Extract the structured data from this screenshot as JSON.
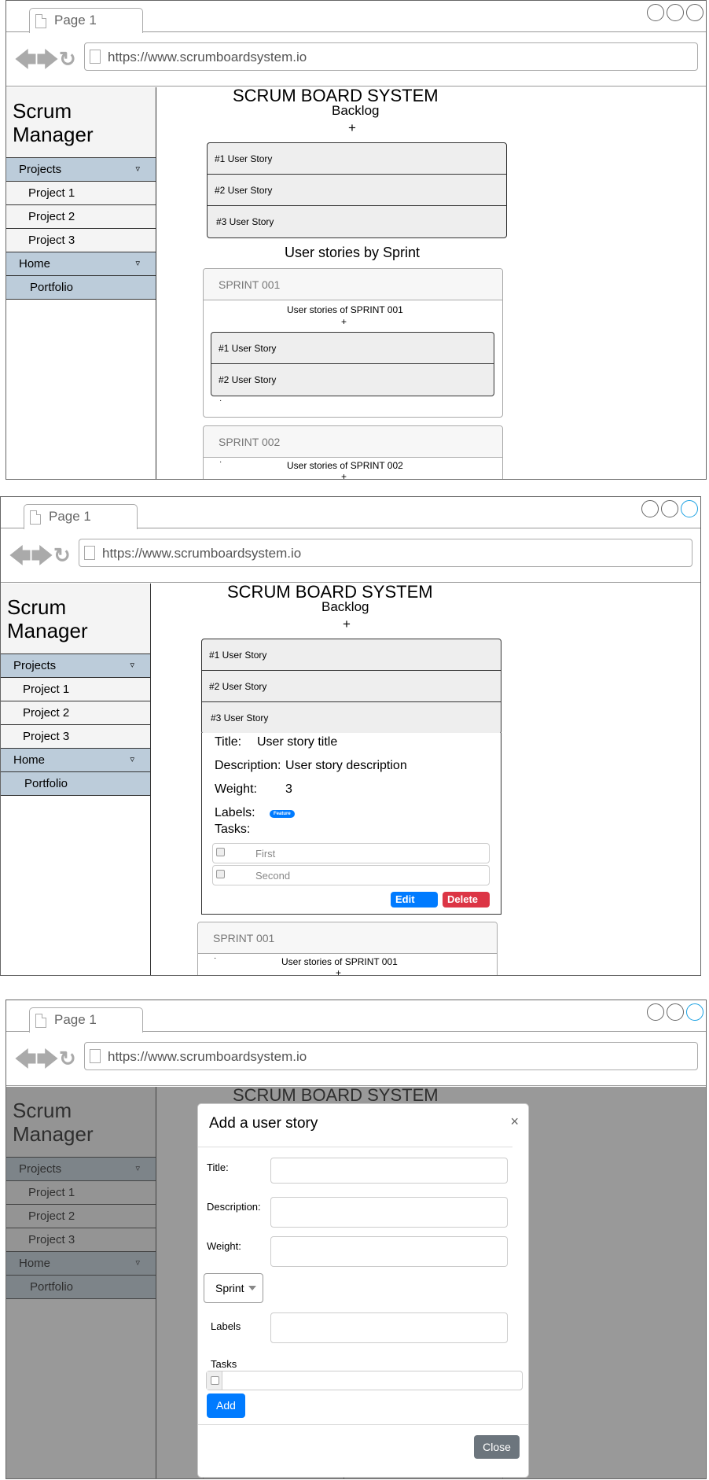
{
  "browser": {
    "tab_label": "Page 1",
    "url": "https://www.scrumboardsystem.io"
  },
  "sidebar": {
    "brand_line1": "Scrum",
    "brand_line2": "Manager",
    "projects_label": "Projects",
    "projects": [
      "Project 1",
      "Project 2",
      "Project 3"
    ],
    "home_label": "Home",
    "portfolio_label": "Portfolio",
    "caret": "▿"
  },
  "board": {
    "title": "SCRUM BOARD SYSTEM",
    "backlog_label": "Backlog",
    "add_symbol": "+",
    "backlog_stories": [
      "#1 User Story",
      "#2 User Story",
      "#3 User Story"
    ],
    "sprints_heading": "User stories by Sprint",
    "sprint_dot": "·",
    "sprints": [
      {
        "name": "SPRINT 001",
        "subtitle": "User stories of SPRINT 001",
        "stories": [
          "#1 User Story",
          "#2 User Story"
        ]
      },
      {
        "name": "SPRINT 002",
        "subtitle": "User stories of SPRINT 002",
        "stories": []
      }
    ]
  },
  "story_detail": {
    "title_label": "Title:",
    "title_value": "User story title",
    "description_label": "Description:",
    "description_value": "User story description",
    "weight_label": "Weight:",
    "weight_value": "3",
    "labels_label": "Labels:",
    "label_badge": "Feature",
    "tasks_label": "Tasks:",
    "tasks": [
      "First",
      "Second"
    ],
    "edit_label": "Edit",
    "delete_label": "Delete"
  },
  "modal": {
    "title": "Add a user story",
    "close_symbol": "×",
    "title_field_label": "Title:",
    "description_field_label": "Description:",
    "weight_field_label": "Weight:",
    "sprint_select_value": "Sprint",
    "labels_field_label": "Labels",
    "tasks_field_label": "Tasks",
    "add_label": "Add",
    "close_label": "Close"
  },
  "colors": {
    "sidebar_section": "#bcccda",
    "primary": "#007bff",
    "danger": "#dc3545",
    "secondary": "#6c757d",
    "overlay": "#808080"
  }
}
